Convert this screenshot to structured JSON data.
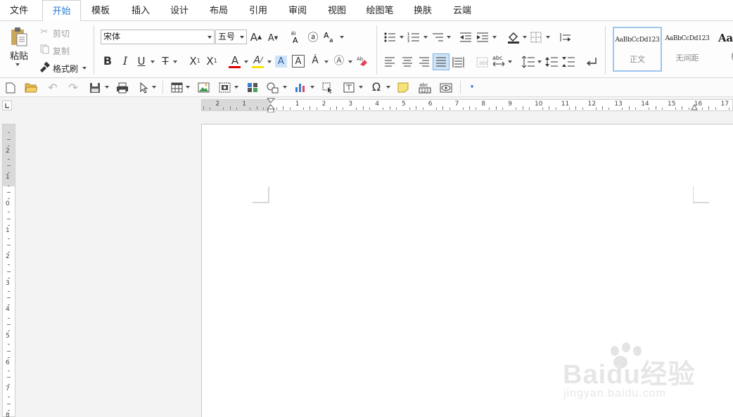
{
  "menubar": {
    "items": [
      "文件",
      "开始",
      "模板",
      "插入",
      "设计",
      "布局",
      "引用",
      "审阅",
      "视图",
      "绘图笔",
      "换肤",
      "云端"
    ],
    "active": "开始"
  },
  "clipboard": {
    "paste_label": "粘贴",
    "cut_label": "剪切",
    "copy_label": "复制",
    "format_painter_label": "格式刷"
  },
  "font": {
    "name": "宋体",
    "size": "五号"
  },
  "styles": [
    {
      "sample": "AaBbCcDd123",
      "label": "正文",
      "selected": true
    },
    {
      "sample": "AaBbCcDd123",
      "label": "无间距",
      "selected": false
    },
    {
      "sample": "AaB",
      "label": "标",
      "selected": false
    }
  ],
  "ruler": {
    "h_numbers_left": [
      "2",
      "1"
    ],
    "h_numbers_right": [
      "1",
      "2",
      "3",
      "4",
      "5",
      "6",
      "7",
      "8",
      "9",
      "10",
      "11",
      "12",
      "13",
      "14",
      "15",
      "16",
      "17"
    ],
    "v_numbers_top": [
      "2",
      "1",
      "0"
    ],
    "v_numbers_bottom": [
      "1",
      "2",
      "3",
      "4",
      "5",
      "6",
      "7",
      "8"
    ]
  },
  "watermark": {
    "brand": "Baidu经验",
    "url": "jingyan.baidu.com"
  },
  "colors": {
    "accent": "#2b7cd3",
    "font_color_bar": "#e00000",
    "highlight_bar": "#f5e400",
    "shade_icon": "#4a7fc1",
    "justify_active": "#cfe3f7"
  }
}
